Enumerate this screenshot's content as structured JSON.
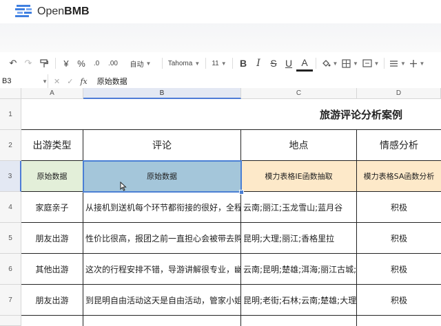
{
  "app": {
    "logo_text_light": "Open",
    "logo_text_bold": "BMB",
    "logo_color": "#3f7fe0"
  },
  "toolbar": {
    "undo": "↶",
    "redo": "↷",
    "paint_format": "🖌",
    "currency": "¥",
    "percent": "%",
    "decimal_dec": ".0",
    "decimal_inc": ".00",
    "number_format": "自动",
    "font_name": "Tahoma",
    "font_size": "11",
    "bold": "B",
    "italic": "I",
    "strike": "S",
    "underline": "U",
    "font_color": "A"
  },
  "formula_bar": {
    "cell_ref": "B3",
    "fx": "fx",
    "value": "原始数据"
  },
  "columns": [
    "A",
    "B",
    "C",
    "D"
  ],
  "rows": [
    "1",
    "2",
    "3",
    "4",
    "5",
    "6",
    "7"
  ],
  "title": "旅游评论分析案例",
  "headers": {
    "a": "出游类型",
    "b": "评论",
    "c": "地点",
    "d": "情感分析"
  },
  "row3": {
    "a": "原始数据",
    "b": "原始数据",
    "c": "模力表格IE函数抽取",
    "d": "模力表格SA函数分析"
  },
  "data_rows": [
    {
      "a": "家庭亲子",
      "b": "从接机到送机每个环节都衔接的很好，全程虽然",
      "c": "云南;丽江;玉龙雪山;蓝月谷",
      "d": "积极"
    },
    {
      "a": "朋友出游",
      "b": "性价比很高，报团之前一直担心会被带去购物啥",
      "c": "昆明;大理;丽江;香格里拉",
      "d": "积极"
    },
    {
      "a": "其他出游",
      "b": "这次的行程安排不错，导游讲解很专业，幽默风",
      "c": "云南;昆明;楚雄;洱海;丽江古城;希腊",
      "d": "积极"
    },
    {
      "a": "朋友出游",
      "b": "到昆明自由活动这天是自由活动，管家小姐姐推",
      "c": "昆明;老街;石林;云南;楚雄;大理;花",
      "d": "积极"
    }
  ],
  "colors": {
    "green_fill": "#e3efd9",
    "blue_fill": "#a4c6da",
    "yellow_fill": "#fde9c9",
    "selection": "#4a7fd4"
  }
}
